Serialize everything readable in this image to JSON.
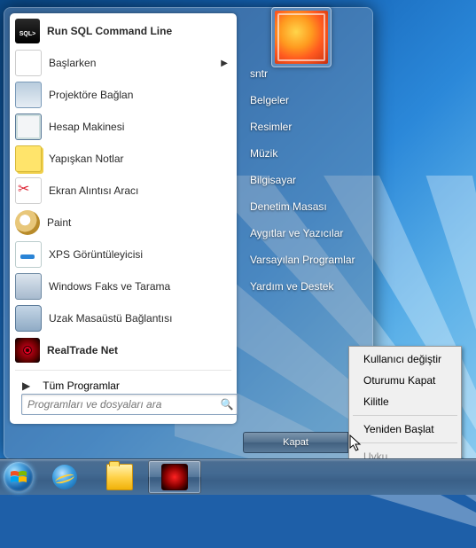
{
  "programs": [
    {
      "label": "Run SQL Command Line",
      "bold": true,
      "icon": "sql-icon",
      "arrow": false
    },
    {
      "label": "Başlarken",
      "bold": false,
      "icon": "getting-started-icon",
      "arrow": true
    },
    {
      "label": "Projektöre Bağlan",
      "bold": false,
      "icon": "projector-icon",
      "arrow": false
    },
    {
      "label": "Hesap Makinesi",
      "bold": false,
      "icon": "calculator-icon",
      "arrow": false
    },
    {
      "label": "Yapışkan Notlar",
      "bold": false,
      "icon": "sticky-notes-icon",
      "arrow": false
    },
    {
      "label": "Ekran Alıntısı Aracı",
      "bold": false,
      "icon": "snipping-tool-icon",
      "arrow": false
    },
    {
      "label": "Paint",
      "bold": false,
      "icon": "paint-icon",
      "arrow": false
    },
    {
      "label": "XPS Görüntüleyicisi",
      "bold": false,
      "icon": "xps-viewer-icon",
      "arrow": false
    },
    {
      "label": "Windows Faks ve Tarama",
      "bold": false,
      "icon": "fax-scan-icon",
      "arrow": false
    },
    {
      "label": "Uzak Masaüstü Bağlantısı",
      "bold": false,
      "icon": "remote-desktop-icon",
      "arrow": false
    },
    {
      "label": "RealTrade Net",
      "bold": true,
      "icon": "realtrade-icon",
      "arrow": false
    }
  ],
  "all_programs": "Tüm Programlar",
  "search_placeholder": "Programları ve dosyaları ara",
  "right_items": [
    "sntr",
    "Belgeler",
    "Resimler",
    "Müzik",
    "Bilgisayar",
    "Denetim Masası",
    "Aygıtlar ve Yazıcılar",
    "Varsayılan Programlar",
    "Yardım ve Destek"
  ],
  "shutdown_label": "Kapat",
  "context_menu": {
    "items": [
      "Kullanıcı değiştir",
      "Oturumu Kapat",
      "Kilitle"
    ],
    "sep_items": [
      "Yeniden Başlat"
    ],
    "disabled": [
      "Uyku"
    ]
  },
  "icon_class": {
    "sql-icon": "ic-sql",
    "getting-started-icon": "ic-start",
    "projector-icon": "ic-proj",
    "calculator-icon": "ic-calc",
    "sticky-notes-icon": "ic-note",
    "snipping-tool-icon": "ic-snip",
    "paint-icon": "ic-paint",
    "xps-viewer-icon": "ic-xps",
    "fax-scan-icon": "ic-fax",
    "remote-desktop-icon": "ic-rdp",
    "realtrade-icon": "ic-rt"
  }
}
